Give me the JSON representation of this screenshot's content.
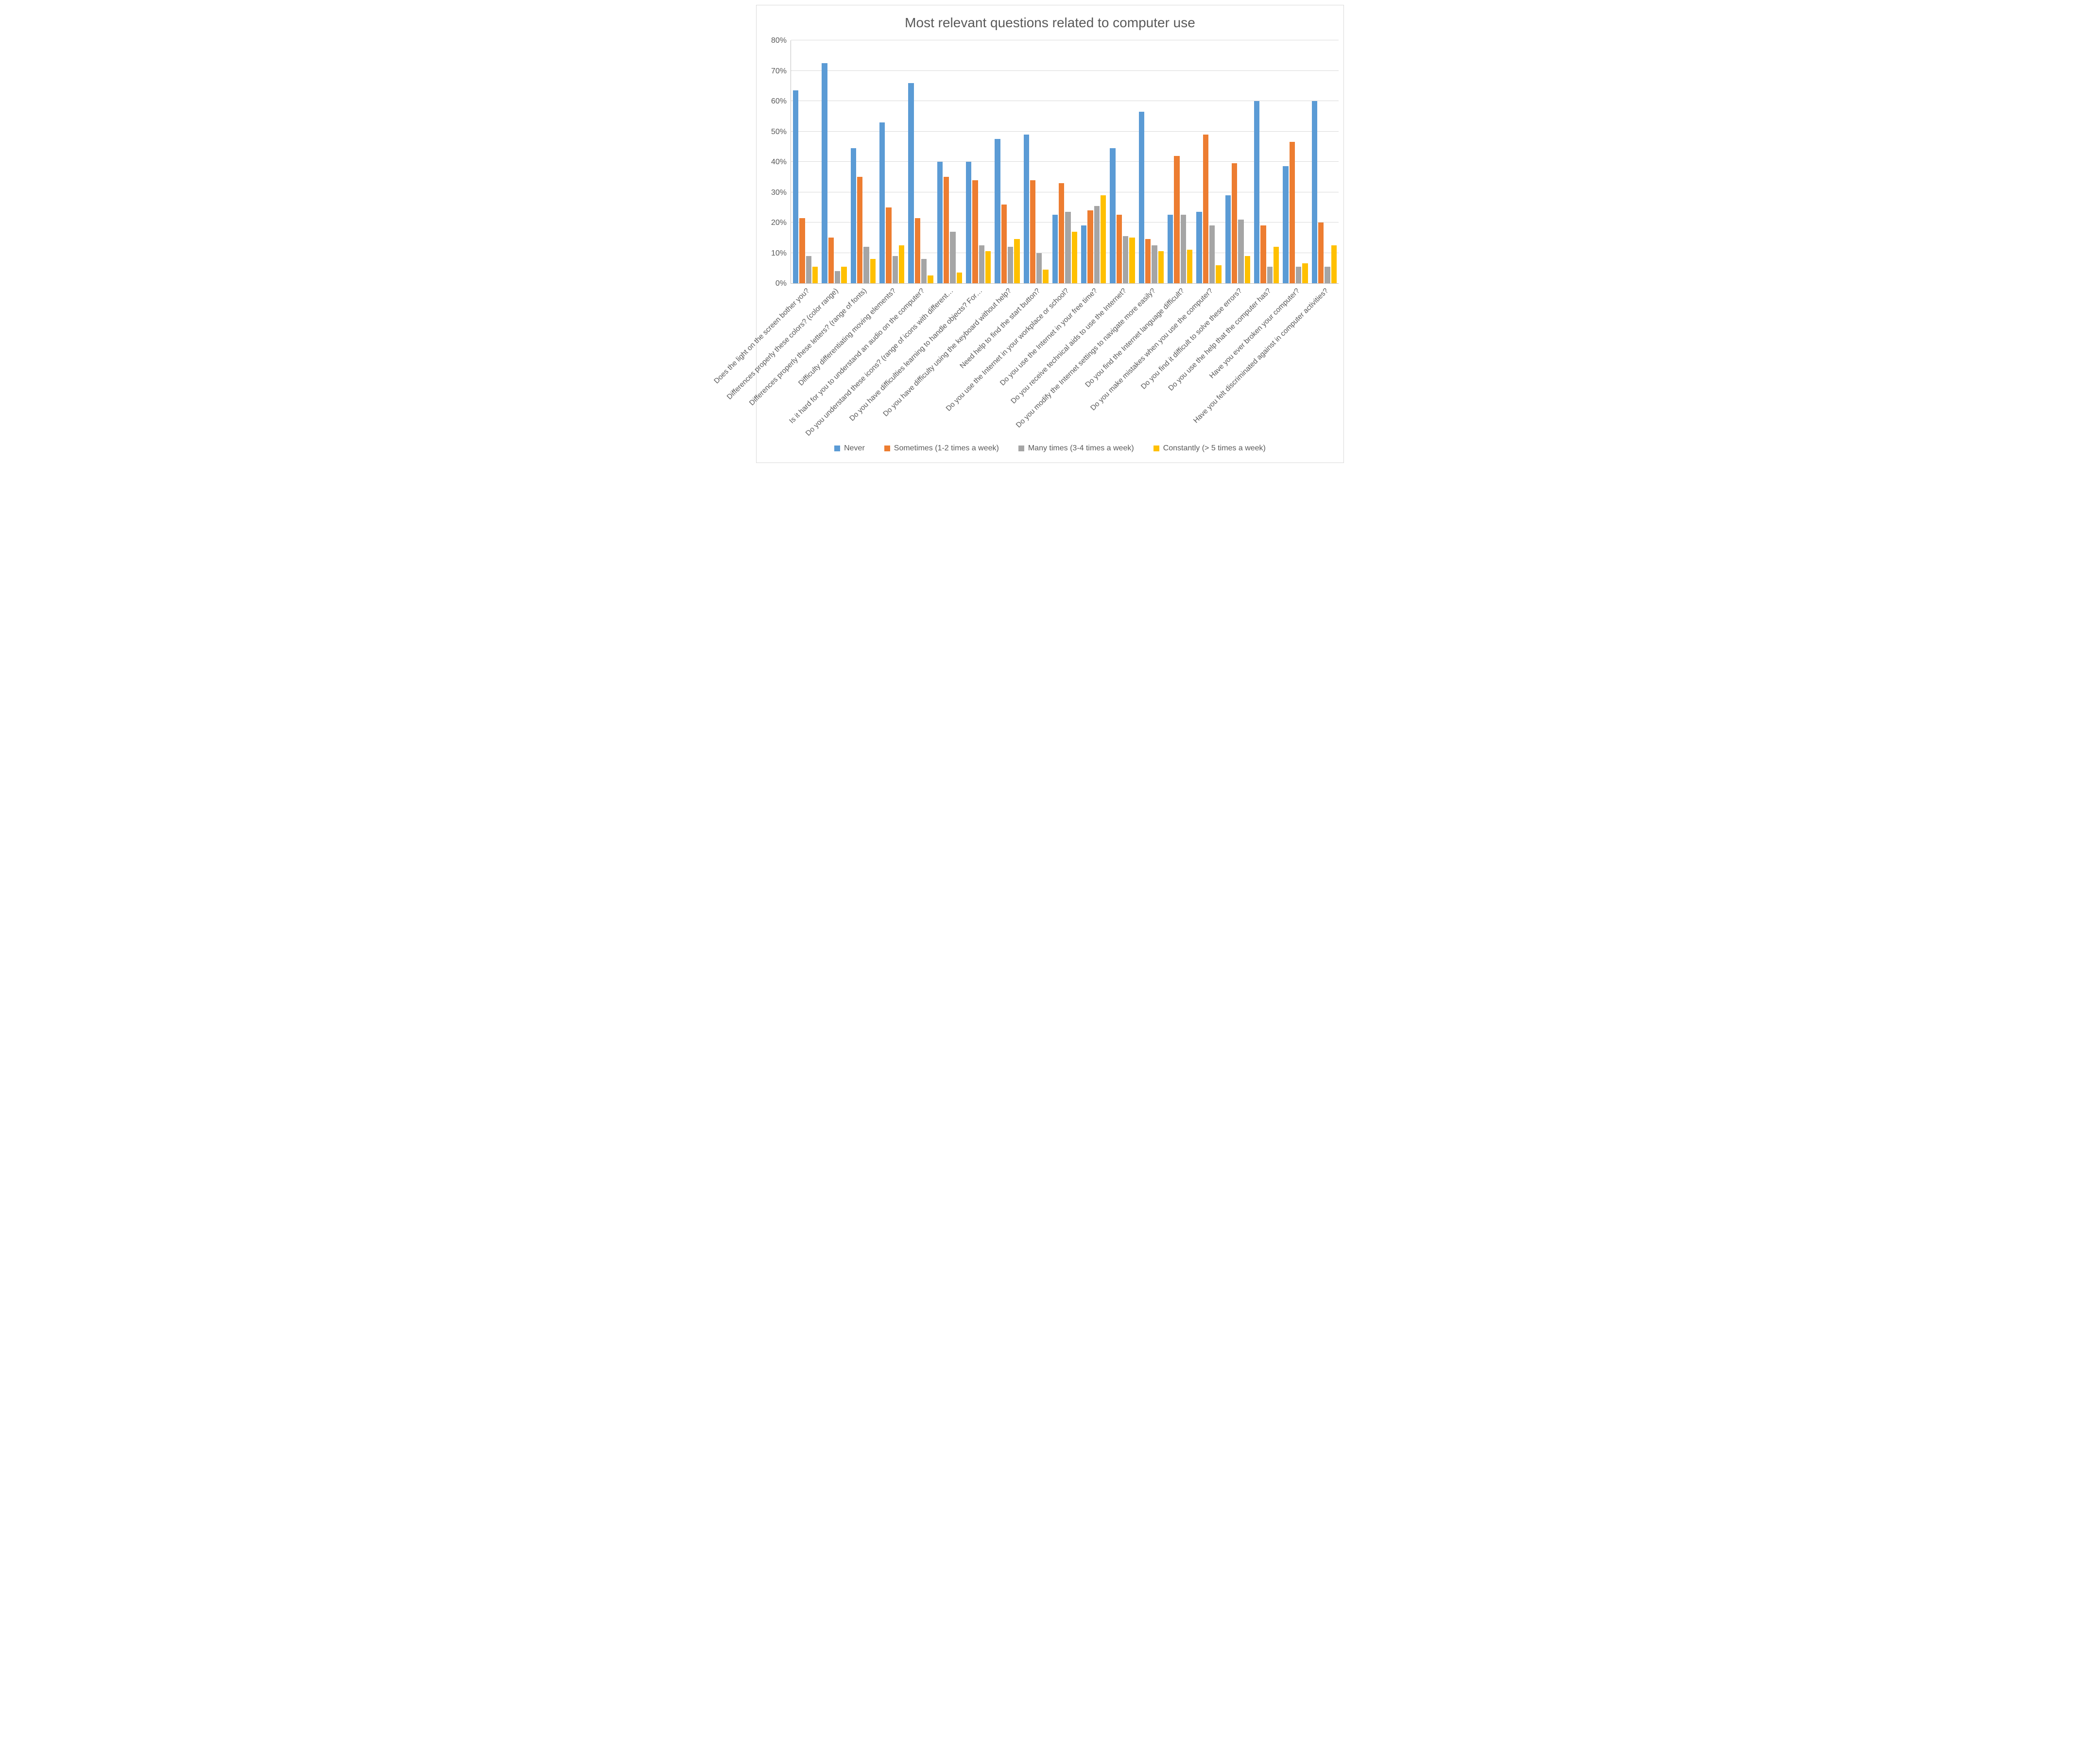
{
  "chart_data": {
    "type": "bar",
    "title": "Most relevant questions related to computer use",
    "ylabel": "",
    "xlabel": "",
    "ylim": [
      0,
      80
    ],
    "y_ticks": [
      0,
      10,
      20,
      30,
      40,
      50,
      60,
      70,
      80
    ],
    "y_tick_suffix": "%",
    "categories": [
      "Does the light on the screen bother you?",
      "Differences properly these colors? (color range)",
      "Differences properly these letters? (range of fonts)",
      "Difficulty differentiating moving elements?",
      "Is it hard for you to understand an audio on the computer?",
      "Do you understand these icons? (range of icons with different…",
      "Do you have difficulties learning to handle objects? For…",
      "Do you have difficulty using the keyboard without help?",
      "Need help to find the start button?",
      "Do you use the Internet in your workplace or school?",
      "Do you use the Internet in your free time?",
      "Do you receive technical aids to use the Internet?",
      "Do you modify the Internet settings to navigate more easily?",
      "Do you find the Internet language difficult?",
      "Do you make mistakes when you use the computer?",
      "Do you find it difficult to solve these errors?",
      "Do you use the help that the computer has?",
      "Have you ever broken your computer?",
      "Have you felt discriminated against in computer activities?"
    ],
    "series": [
      {
        "name": "Never",
        "color": "#5b9bd5",
        "values": [
          63.5,
          72.5,
          44.5,
          53.0,
          66.0,
          40.0,
          40.0,
          47.5,
          49.0,
          22.5,
          19.0,
          44.5,
          56.5,
          22.5,
          23.5,
          29.0,
          60.0,
          38.5,
          60.0
        ]
      },
      {
        "name": "Sometimes (1-2 times a week)",
        "color": "#ed7d31",
        "values": [
          21.5,
          15.0,
          35.0,
          25.0,
          21.5,
          35.0,
          34.0,
          26.0,
          34.0,
          33.0,
          24.0,
          22.5,
          14.5,
          42.0,
          49.0,
          39.5,
          19.0,
          46.5,
          20.0
        ]
      },
      {
        "name": "Many times (3-4 times a week)",
        "color": "#a5a5a5",
        "values": [
          9.0,
          4.0,
          12.0,
          9.0,
          8.0,
          17.0,
          12.5,
          12.0,
          10.0,
          23.5,
          25.5,
          15.5,
          12.5,
          22.5,
          19.0,
          21.0,
          5.5,
          5.5,
          5.5
        ]
      },
      {
        "name": "Constantly (> 5 times a week)",
        "color": "#ffc000",
        "values": [
          5.5,
          5.5,
          8.0,
          12.5,
          2.5,
          3.5,
          10.5,
          14.5,
          4.5,
          17.0,
          29.0,
          15.0,
          10.5,
          11.0,
          6.0,
          9.0,
          12.0,
          6.5,
          12.5
        ]
      }
    ],
    "legend_position": "bottom",
    "grid": true
  }
}
